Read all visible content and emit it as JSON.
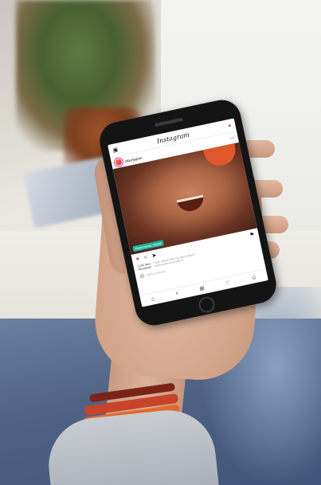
{
  "app": {
    "logo": "Instagram",
    "username": "nkiunjapan",
    "location_tag": "Kathmandu, Nepal",
    "likes": "1,000 likes",
    "caption_user": "nkiunjapan",
    "caption_text": "Nunc aliquet diam ac lacus aliquet malesuada lorem ipsum",
    "comment_placeholder": "Add a comment..."
  },
  "icons": {
    "camera": "▣",
    "send": "●",
    "more": "⋯",
    "like": "♥",
    "comment": "○",
    "share": "➤",
    "bookmark": "⚑",
    "home": "⌂",
    "search": "⌕",
    "add": "⊞",
    "activity": "♡",
    "profile": "☺"
  },
  "colors": {
    "like": "#ed4956",
    "tag": "#20b39a"
  }
}
